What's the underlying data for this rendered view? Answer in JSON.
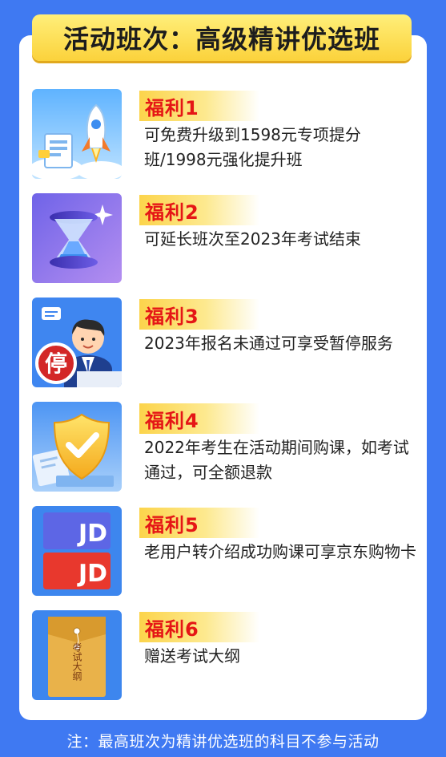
{
  "title": "活动班次：高级精讲优选班",
  "benefits": [
    {
      "label": "福利1",
      "desc": "可免费升级到1598元专项提分班/1998元强化提升班",
      "icon": "rocket-icon"
    },
    {
      "label": "福利2",
      "desc": "可延长班次至2023年考试结束",
      "icon": "hourglass-icon"
    },
    {
      "label": "福利3",
      "desc": "2023年报名未通过可享受暂停服务",
      "icon": "pause-service-icon",
      "icon_text": "停"
    },
    {
      "label": "福利4",
      "desc": "2022年考生在活动期间购课，如考试通过，可全额退款",
      "icon": "shield-check-icon"
    },
    {
      "label": "福利5",
      "desc": "老用户转介绍成功购课可享京东购物卡",
      "icon": "jd-card-icon",
      "icon_text": "JD"
    },
    {
      "label": "福利6",
      "desc": "赠送考试大纲",
      "icon": "envelope-icon",
      "icon_text": "考试大纲"
    }
  ],
  "note": "注：最高班次为精讲优选班的科目不参与活动",
  "colors": {
    "background": "#3f79f2",
    "badge_text": "#e51616",
    "title_tab": "#fcd44b"
  }
}
